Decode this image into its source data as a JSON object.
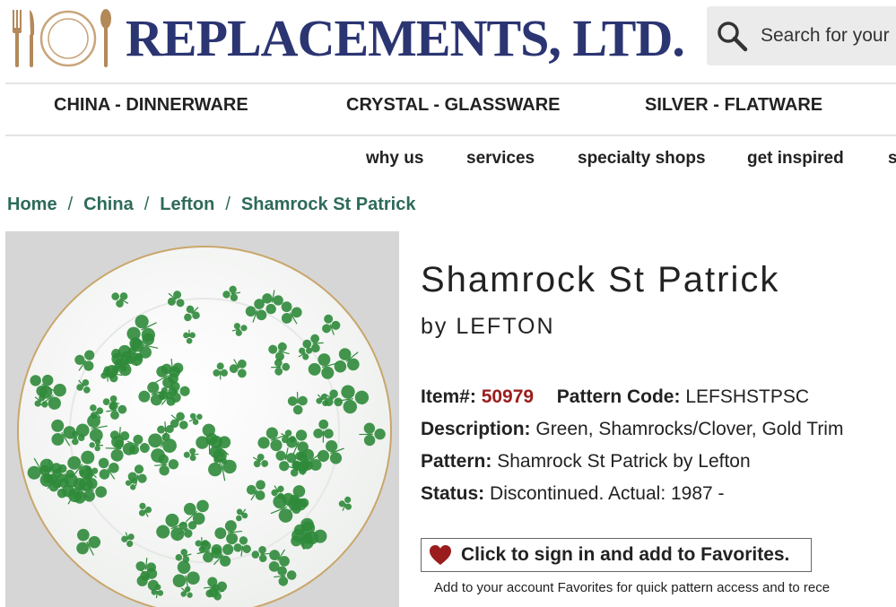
{
  "brand": {
    "name": "REPLACEMENTS, LTD."
  },
  "search": {
    "placeholder": "Search for your"
  },
  "categories": [
    "CHINA - DINNERWARE",
    "CRYSTAL - GLASSWARE",
    "SILVER - FLATWARE"
  ],
  "subnav": [
    "why us",
    "services",
    "specialty shops",
    "get inspired",
    "s"
  ],
  "breadcrumb": [
    "Home",
    "China",
    "Lefton",
    "Shamrock St Patrick"
  ],
  "breadcrumb_sep": "/",
  "product": {
    "title": "Shamrock St Patrick",
    "byline": "by LEFTON",
    "item_label": "Item#:",
    "item_number": "50979",
    "pattern_code_label": "Pattern Code:",
    "pattern_code": "LEFSHSTPSC",
    "description_label": "Description:",
    "description": "Green, Shamrocks/Clover, Gold Trim",
    "pattern_label": "Pattern:",
    "pattern": "Shamrock St Patrick by Lefton",
    "status_label": "Status:",
    "status": "Discontinued. Actual: 1987 -"
  },
  "favorites": {
    "button_label": "Click to sign in and add to Favorites.",
    "note": "Add to your account Favorites for quick pattern access and to rece"
  },
  "colors": {
    "brand": "#2b3572",
    "breadcrumb": "#2e6a5a",
    "item_number": "#9b1c1c",
    "heart": "#9b1c1c",
    "shamrock": "#2f8a3a"
  }
}
